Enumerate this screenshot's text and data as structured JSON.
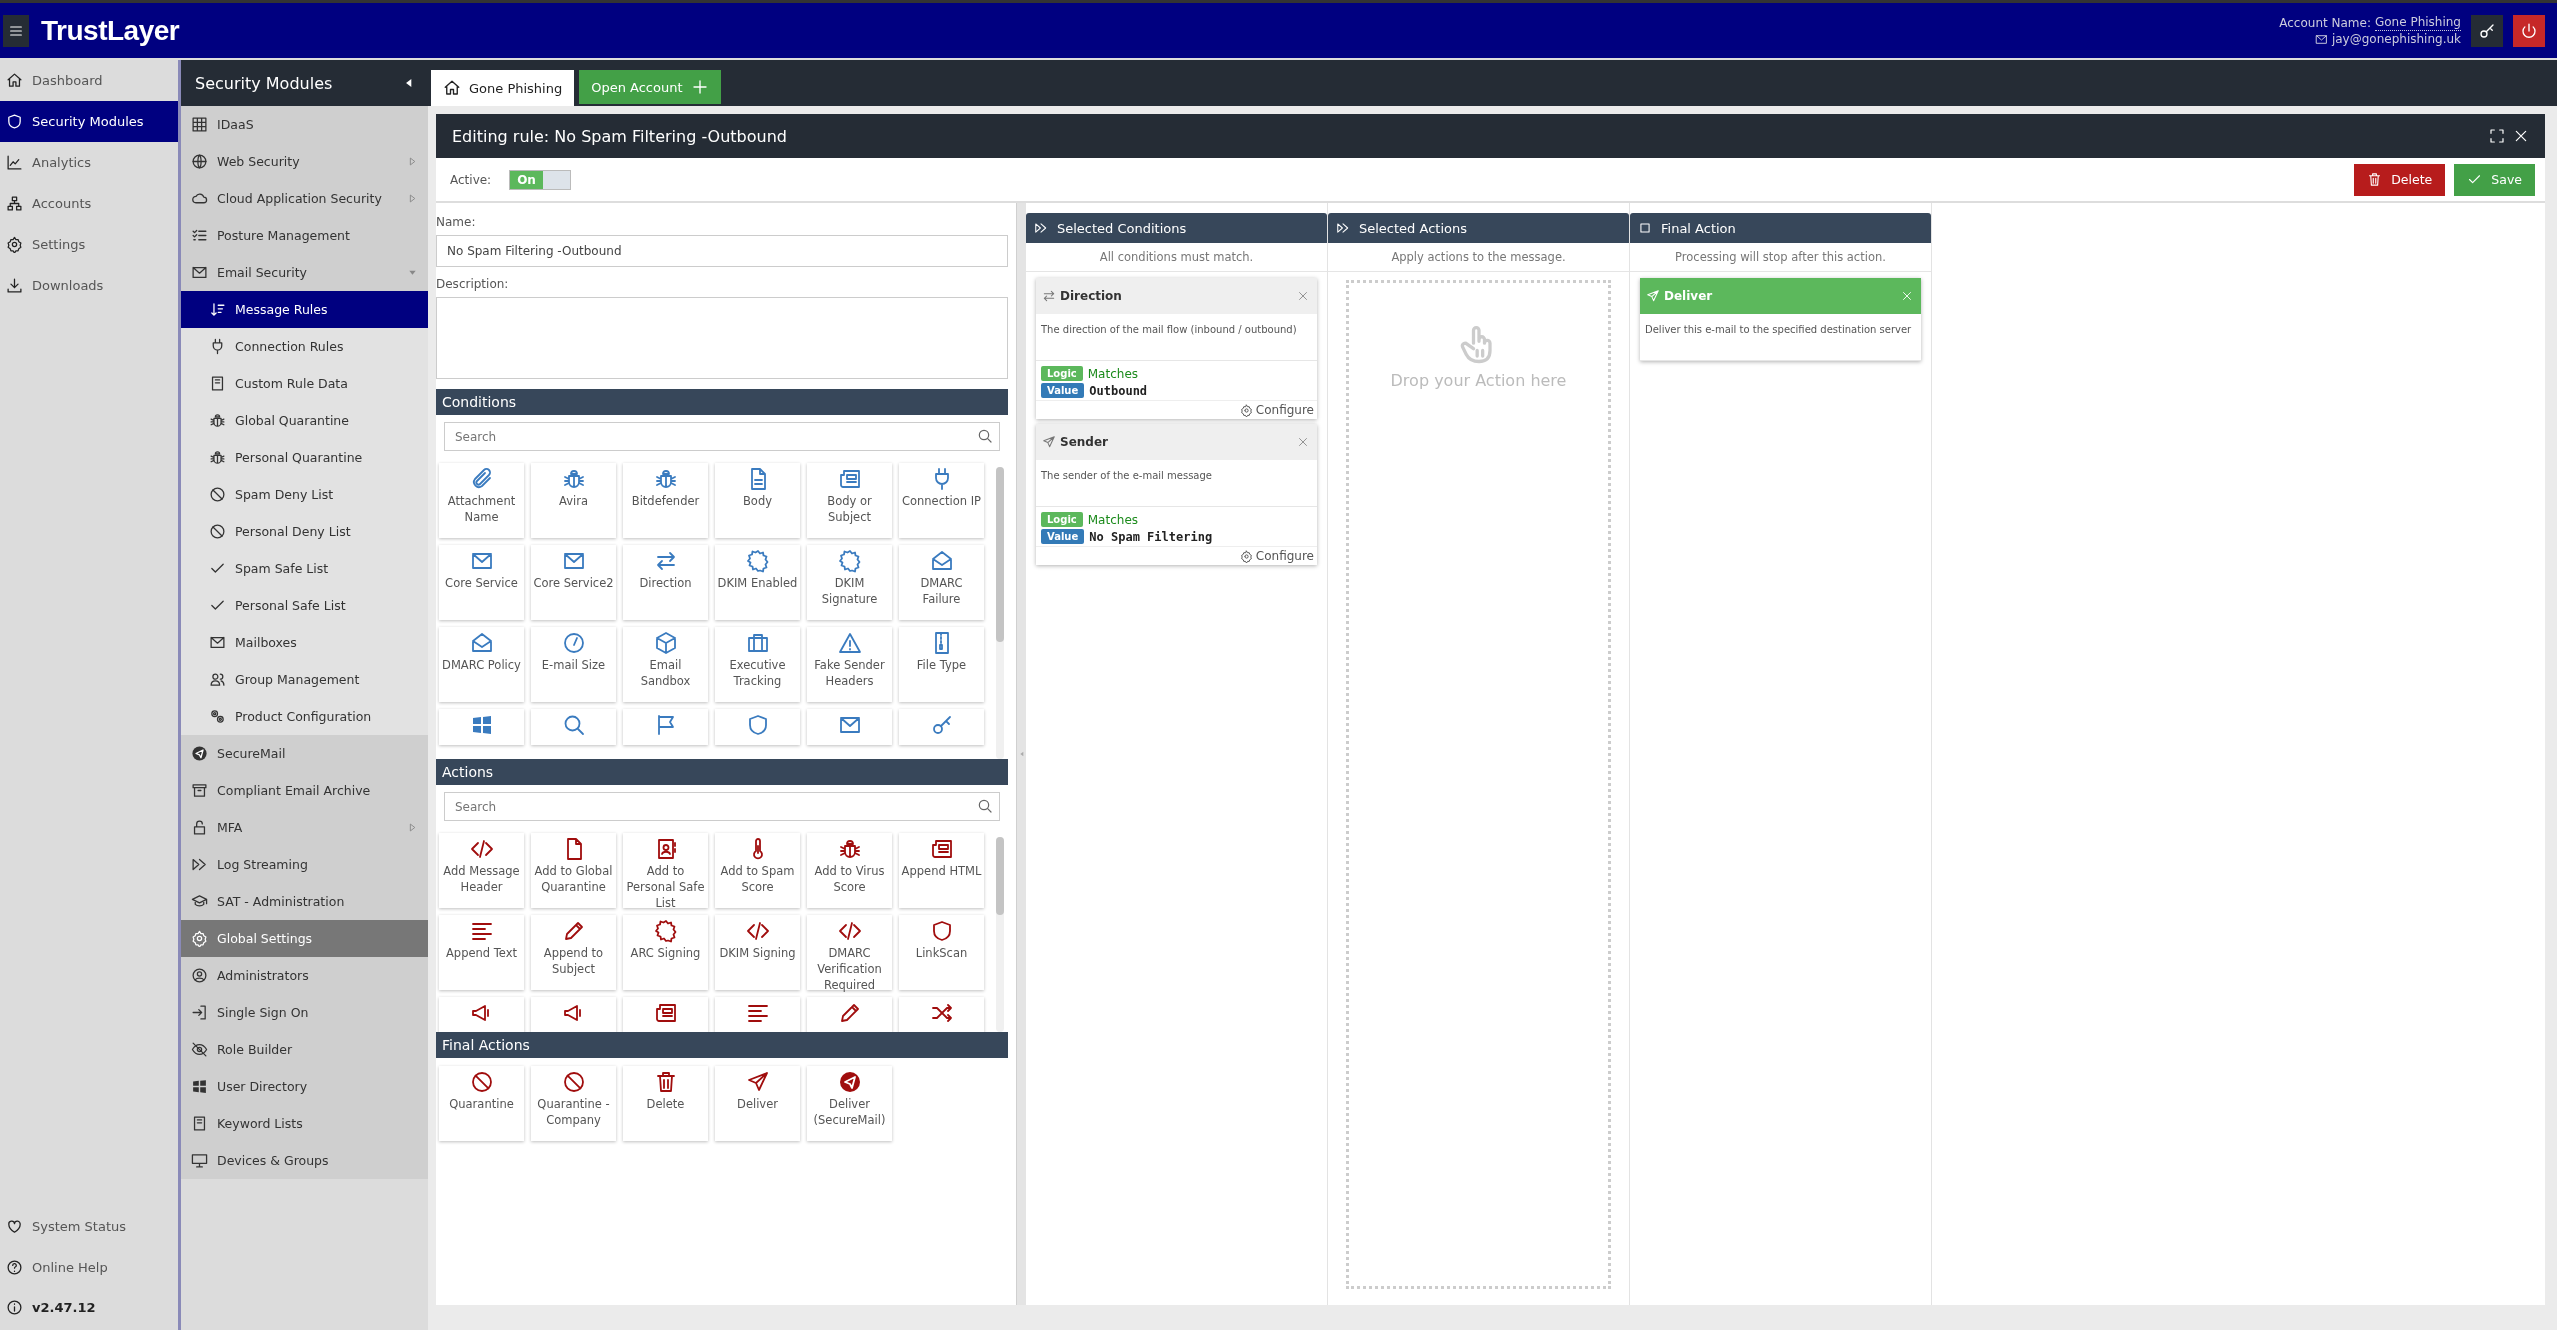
{
  "header": {
    "logo": "TrustLayer",
    "account_label": "Account Name:",
    "account_name": "Gone Phishing",
    "email": "jay@gonephishing.uk"
  },
  "nav": {
    "items": [
      {
        "label": "Dashboard",
        "selected": false
      },
      {
        "label": "Security Modules",
        "selected": true
      },
      {
        "label": "Analytics",
        "selected": false
      },
      {
        "label": "Accounts",
        "selected": false
      },
      {
        "label": "Settings",
        "selected": false
      },
      {
        "label": "Downloads",
        "selected": false
      }
    ],
    "footer": [
      {
        "label": "System Status",
        "kind": "link"
      },
      {
        "label": "Online Help",
        "kind": "link"
      },
      {
        "label": "v2.47.12",
        "kind": "version"
      }
    ]
  },
  "modules": {
    "title": "Security Modules",
    "items": [
      {
        "label": "IDaaS",
        "kind": "item",
        "has_submenu": false,
        "selected": false
      },
      {
        "label": "Web Security",
        "kind": "item",
        "has_submenu": true,
        "selected": false
      },
      {
        "label": "Cloud Application Security",
        "kind": "item",
        "has_submenu": true,
        "selected": false
      },
      {
        "label": "Posture Management",
        "kind": "item",
        "has_submenu": false,
        "selected": false
      },
      {
        "label": "Email Security",
        "kind": "item",
        "has_submenu": true,
        "expanded": true,
        "selected": false,
        "children": [
          {
            "label": "Message Rules",
            "selected": true
          },
          {
            "label": "Connection Rules",
            "selected": false
          },
          {
            "label": "Custom Rule Data",
            "selected": false
          },
          {
            "label": "Global Quarantine",
            "selected": false
          },
          {
            "label": "Personal Quarantine",
            "selected": false
          },
          {
            "label": "Spam Deny List",
            "selected": false
          },
          {
            "label": "Personal Deny List",
            "selected": false
          },
          {
            "label": "Spam Safe List",
            "selected": false
          },
          {
            "label": "Personal Safe List",
            "selected": false
          },
          {
            "label": "Mailboxes",
            "selected": false
          },
          {
            "label": "Group Management",
            "selected": false
          },
          {
            "label": "Product Configuration",
            "selected": false
          }
        ]
      },
      {
        "label": "SecureMail",
        "kind": "item",
        "has_submenu": false,
        "selected": false
      },
      {
        "label": "Compliant Email Archive",
        "kind": "item",
        "has_submenu": false,
        "selected": false
      },
      {
        "label": "MFA",
        "kind": "item",
        "has_submenu": true,
        "selected": false
      },
      {
        "label": "Log Streaming",
        "kind": "item",
        "has_submenu": false,
        "selected": false
      },
      {
        "label": "SAT - Administration",
        "kind": "item",
        "has_submenu": false,
        "selected": false
      },
      {
        "label": "Global Settings",
        "kind": "heading",
        "has_submenu": false,
        "selected": false
      },
      {
        "label": "Administrators",
        "kind": "item",
        "has_submenu": false,
        "selected": false
      },
      {
        "label": "Single Sign On",
        "kind": "item",
        "has_submenu": false,
        "selected": false
      },
      {
        "label": "Role Builder",
        "kind": "item",
        "has_submenu": false,
        "selected": false
      },
      {
        "label": "User Directory",
        "kind": "item",
        "has_submenu": false,
        "selected": false
      },
      {
        "label": "Keyword Lists",
        "kind": "item",
        "has_submenu": false,
        "selected": false
      },
      {
        "label": "Devices & Groups",
        "kind": "item",
        "has_submenu": false,
        "selected": false
      }
    ]
  },
  "tabs": [
    {
      "label": "Gone Phishing",
      "kind": "home",
      "selected": true
    },
    {
      "label": "Open Account",
      "kind": "add",
      "selected": false
    }
  ],
  "editor": {
    "title": "Editing rule: No Spam Filtering -Outbound",
    "active_label": "Active:",
    "active": {
      "on": true,
      "label": "On"
    },
    "delete": "Delete",
    "save": "Save",
    "name_label": "Name:",
    "name": "No Spam Filtering -Outbound",
    "description_label": "Description:"
  },
  "conditions": {
    "title": "Conditions",
    "search_placeholder": "Search",
    "items": [
      "Attachment Name",
      "Avira",
      "Bitdefender",
      "Body",
      "Body or Subject",
      "Connection IP",
      "Core Service",
      "Core Service2",
      "Direction",
      "DKIM Enabled",
      "DKIM Signature",
      "DMARC Failure",
      "DMARC Policy",
      "E-mail Size",
      "Email Sandbox",
      "Executive Tracking",
      "Fake Sender Headers",
      "File Type"
    ]
  },
  "actions": {
    "title": "Actions",
    "search_placeholder": "Search",
    "items": [
      "Add Message Header",
      "Add to Global Quarantine",
      "Add to Personal Safe List",
      "Add to Spam Score",
      "Add to Virus Score",
      "Append HTML",
      "Append Text",
      "Append to Subject",
      "ARC Signing",
      "DKIM Signing",
      "DMARC Verification Required",
      "LinkScan"
    ]
  },
  "final_actions": {
    "title": "Final Actions",
    "items": [
      "Quarantine",
      "Quarantine - Company",
      "Delete",
      "Deliver",
      "Deliver (SecureMail)"
    ]
  },
  "selected_conditions": {
    "title": "Selected Conditions",
    "subtitle": "All conditions must match.",
    "cards": [
      {
        "title": "Direction",
        "description": "The direction of the mail flow (inbound / outbound)",
        "logic_label": "Logic",
        "logic": "Matches",
        "value_label": "Value",
        "value": "Outbound",
        "configure": "Configure"
      },
      {
        "title": "Sender",
        "description": "The sender of the e-mail message",
        "logic_label": "Logic",
        "logic": "Matches",
        "value_label": "Value",
        "value": "No Spam Filtering",
        "configure": "Configure"
      }
    ]
  },
  "selected_actions": {
    "title": "Selected Actions",
    "subtitle": "Apply actions to the message.",
    "placeholder": "Drop your Action here"
  },
  "final_action": {
    "title": "Final Action",
    "subtitle": "Processing will stop after this action.",
    "card": {
      "title": "Deliver",
      "description": "Deliver this e-mail to the specified destination server"
    }
  }
}
